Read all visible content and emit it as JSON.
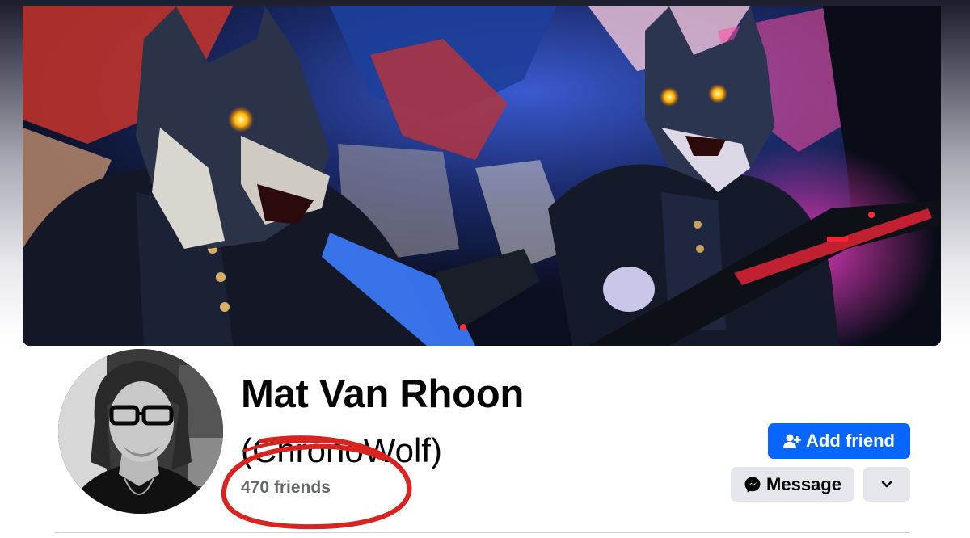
{
  "profile": {
    "name": "Mat Van Rhoon",
    "alternate_name": "(ChronoWolf)",
    "friends_count": "470 friends"
  },
  "actions": {
    "add_friend_label": "Add friend",
    "message_label": "Message",
    "more_icon": "chevron-down-icon",
    "add_friend_icon": "person-add-icon",
    "message_icon": "messenger-icon"
  },
  "colors": {
    "primary_button": "#0866ff",
    "secondary_button": "#e4e6eb",
    "annotation": "#d8231f",
    "muted_text": "#65676b"
  }
}
